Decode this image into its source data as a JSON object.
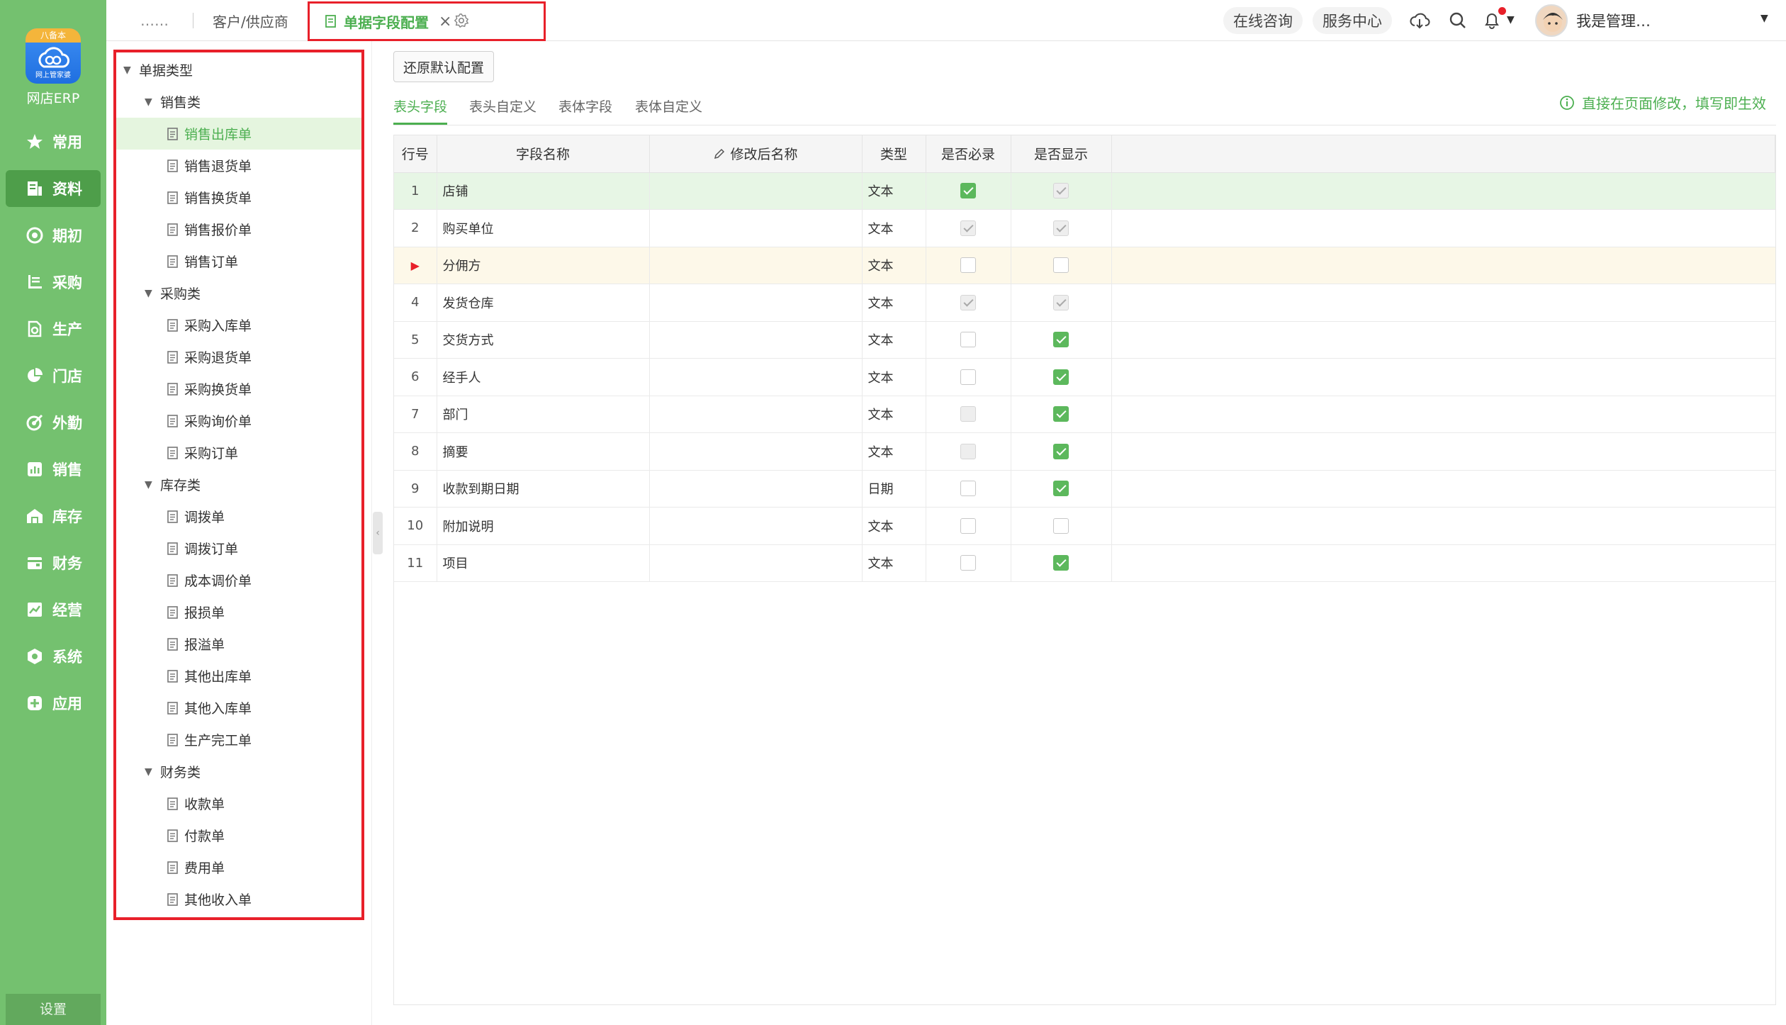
{
  "app": {
    "logo_ribbon": "八备本",
    "logo_sub": "网上管家婆",
    "name": "网店ERP"
  },
  "nav": {
    "items": [
      {
        "label": "常用",
        "icon": "star-icon"
      },
      {
        "label": "资料",
        "icon": "document-icon",
        "active": true
      },
      {
        "label": "期初",
        "icon": "circle-target-icon"
      },
      {
        "label": "采购",
        "icon": "purchase-icon"
      },
      {
        "label": "生产",
        "icon": "production-icon"
      },
      {
        "label": "门店",
        "icon": "pie-icon"
      },
      {
        "label": "外勤",
        "icon": "field-target-icon"
      },
      {
        "label": "销售",
        "icon": "bar-chart-icon"
      },
      {
        "label": "库存",
        "icon": "warehouse-icon"
      },
      {
        "label": "财务",
        "icon": "wallet-icon"
      },
      {
        "label": "经营",
        "icon": "trend-icon"
      },
      {
        "label": "系统",
        "icon": "hexagon-icon"
      },
      {
        "label": "应用",
        "icon": "plus-square-icon"
      }
    ],
    "settings_label": "设置"
  },
  "topbar": {
    "more_label": "……",
    "tab_customer": "客户/供应商",
    "tab_active": "单据字段配置",
    "tab_close": "×",
    "consult_label": "在线咨询",
    "service_label": "服务中心",
    "user_name": "我是管理…"
  },
  "tree": {
    "root": "单据类型",
    "groups": [
      {
        "label": "销售类",
        "items": [
          "销售出库单",
          "销售退货单",
          "销售换货单",
          "销售报价单",
          "销售订单"
        ]
      },
      {
        "label": "采购类",
        "items": [
          "采购入库单",
          "采购退货单",
          "采购换货单",
          "采购询价单",
          "采购订单"
        ]
      },
      {
        "label": "库存类",
        "items": [
          "调拨单",
          "调拨订单",
          "成本调价单",
          "报损单",
          "报溢单",
          "其他出库单",
          "其他入库单",
          "生产完工单"
        ]
      },
      {
        "label": "财务类",
        "items": [
          "收款单",
          "付款单",
          "费用单",
          "其他收入单"
        ]
      }
    ],
    "selected": "销售出库单"
  },
  "main": {
    "restore_label": "还原默认配置",
    "subtabs": [
      "表头字段",
      "表头自定义",
      "表体字段",
      "表体自定义"
    ],
    "active_subtab": 0,
    "hint": "直接在页面修改，填写即生效"
  },
  "grid": {
    "columns": [
      "行号",
      "字段名称",
      "修改后名称",
      "类型",
      "是否必录",
      "是否显示"
    ],
    "rows": [
      {
        "no": "1",
        "name": "店铺",
        "type": "文本",
        "required": "on",
        "show": "dis-on",
        "hl": "green"
      },
      {
        "no": "2",
        "name": "购买单位",
        "type": "文本",
        "required": "dis-on",
        "show": "dis-on"
      },
      {
        "no": "",
        "name": "分佣方",
        "type": "文本",
        "required": "off",
        "show": "off",
        "hl": "yellow",
        "current": true
      },
      {
        "no": "4",
        "name": "发货仓库",
        "type": "文本",
        "required": "dis-on",
        "show": "dis-on"
      },
      {
        "no": "5",
        "name": "交货方式",
        "type": "文本",
        "required": "off",
        "show": "on"
      },
      {
        "no": "6",
        "name": "经手人",
        "type": "文本",
        "required": "off",
        "show": "on"
      },
      {
        "no": "7",
        "name": "部门",
        "type": "文本",
        "required": "dis-off",
        "show": "on"
      },
      {
        "no": "8",
        "name": "摘要",
        "type": "文本",
        "required": "dis-off",
        "show": "on"
      },
      {
        "no": "9",
        "name": "收款到期日期",
        "type": "日期",
        "required": "off",
        "show": "on"
      },
      {
        "no": "10",
        "name": "附加说明",
        "type": "文本",
        "required": "off",
        "show": "off"
      },
      {
        "no": "11",
        "name": "项目",
        "type": "文本",
        "required": "off",
        "show": "on"
      }
    ]
  },
  "colors": {
    "sidebar": "#74c16f",
    "accent": "#4caf50",
    "highlight_border": "#e8202a"
  }
}
